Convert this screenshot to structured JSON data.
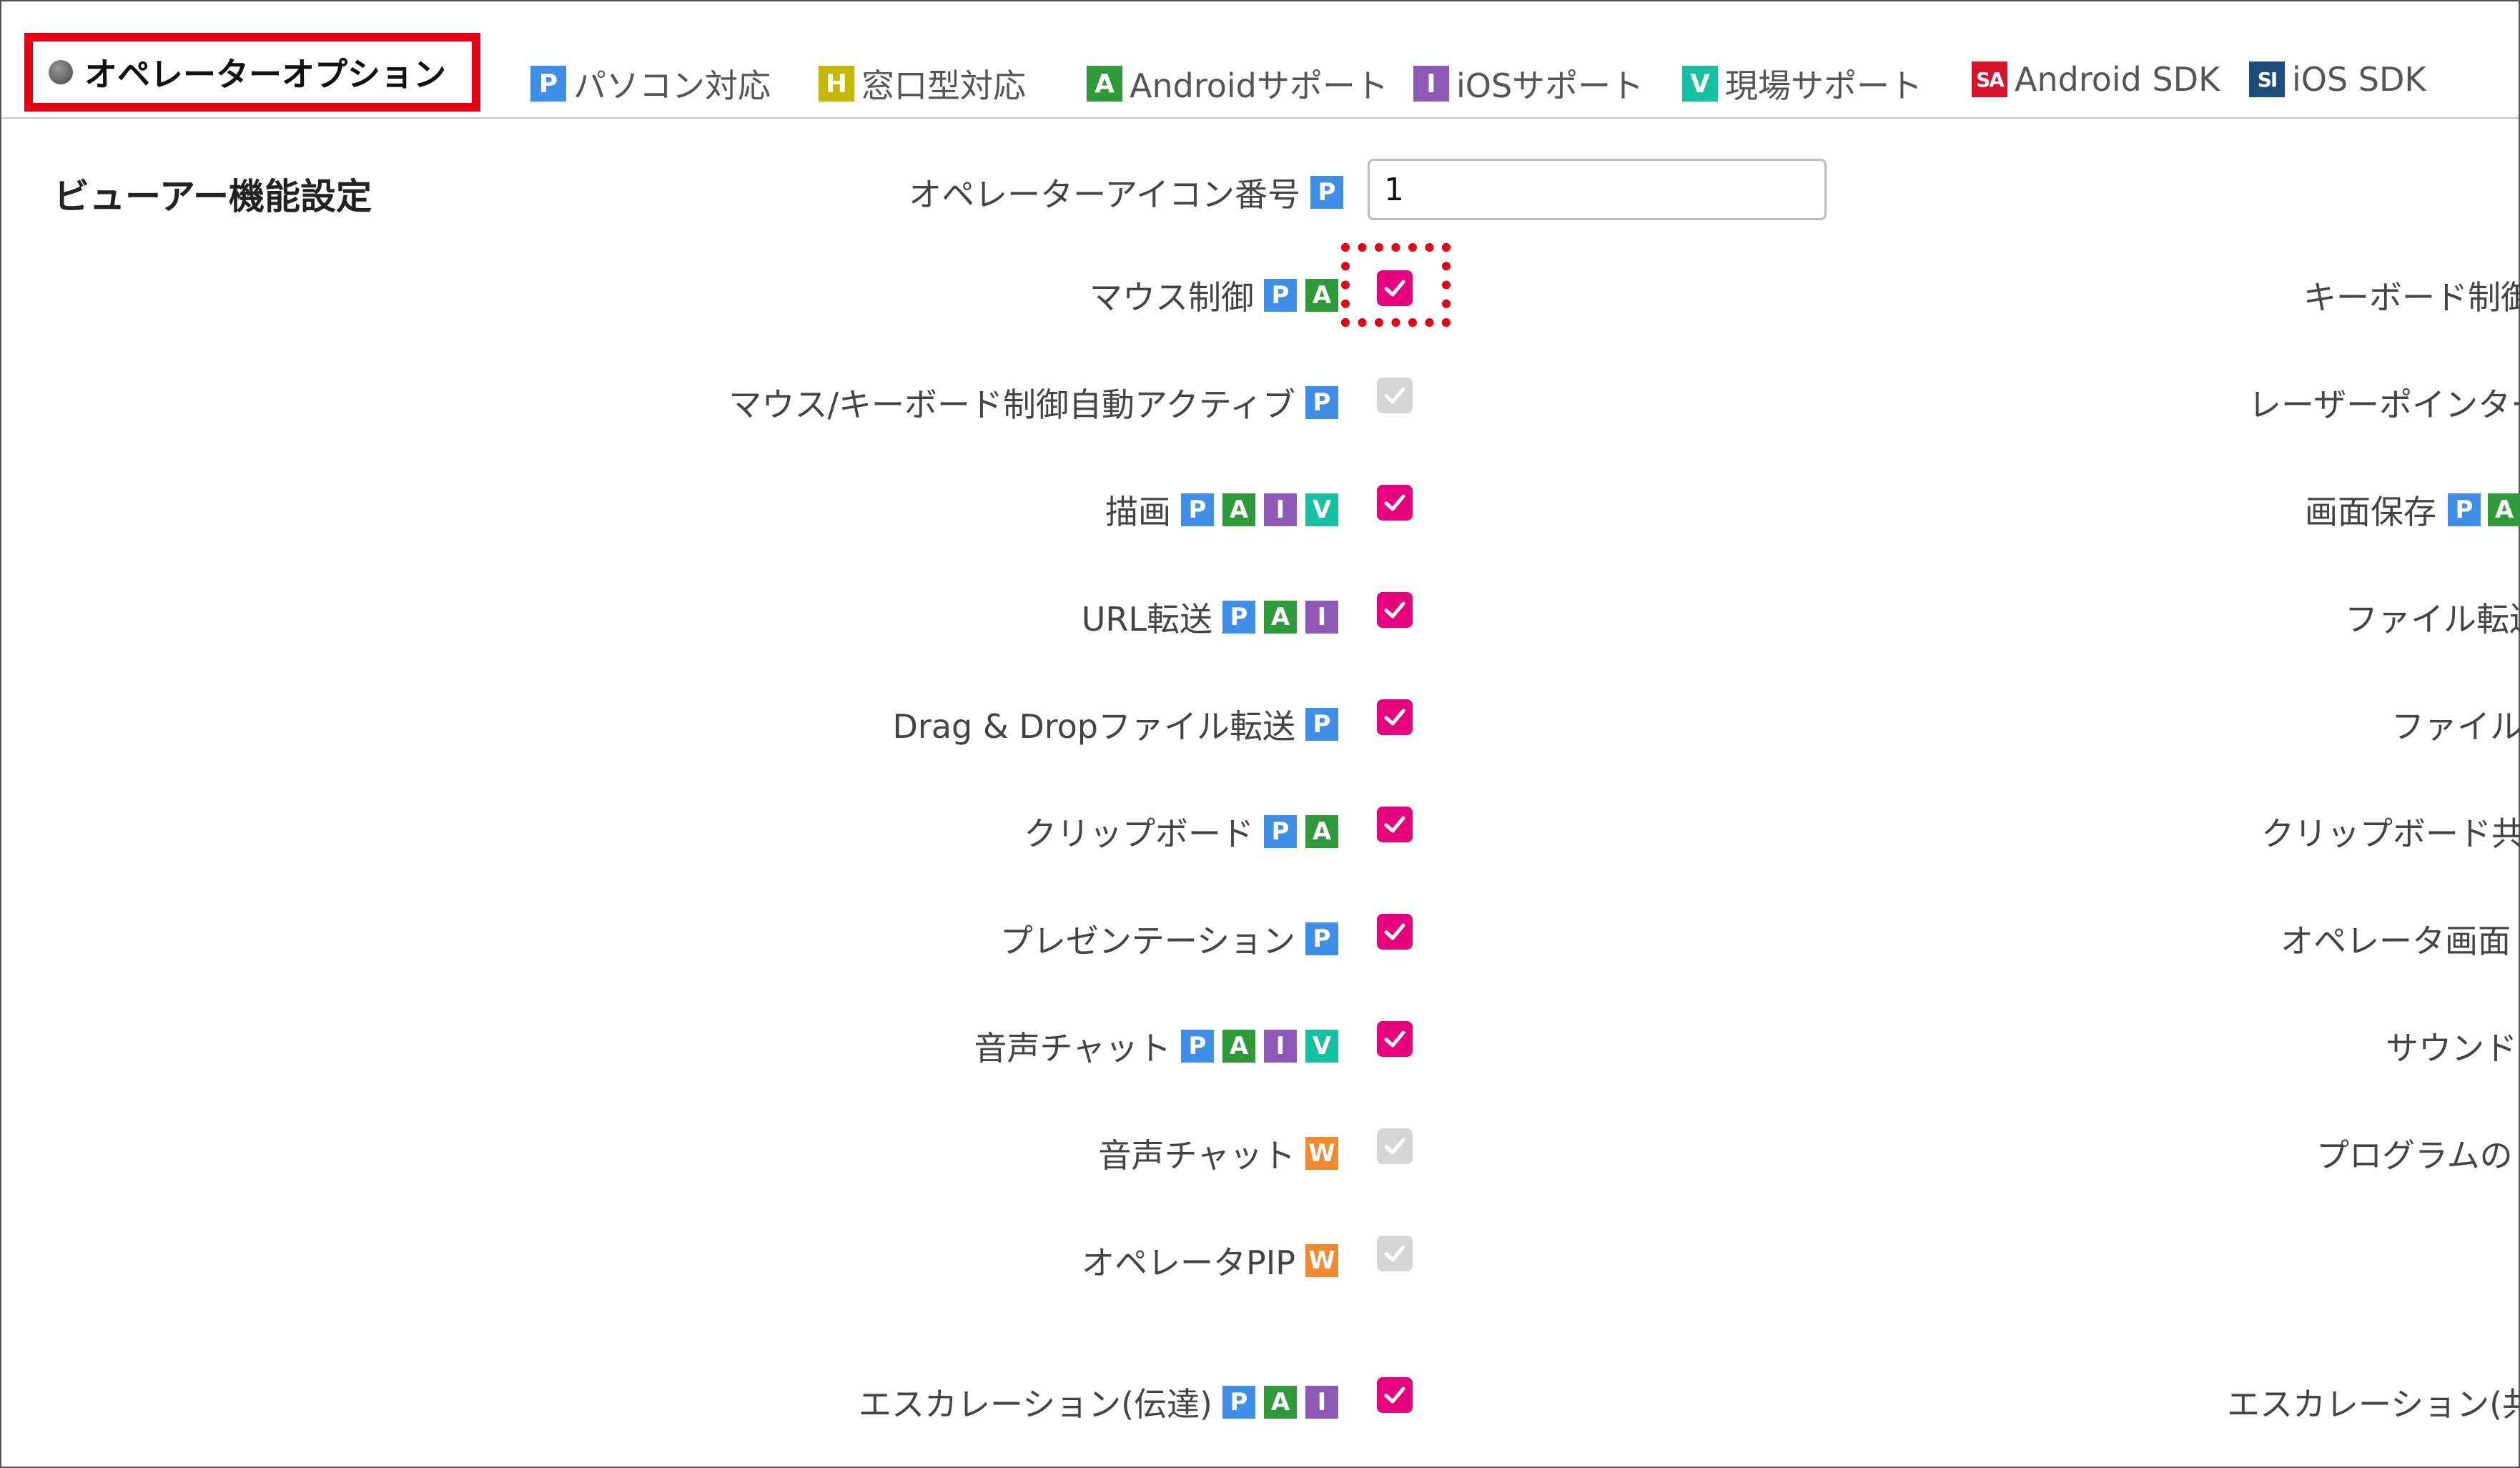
{
  "colors": {
    "accent": "#e6007e",
    "highlight": "#e60012",
    "P": "#3f8ee8",
    "H": "#c5b900",
    "A": "#2e9a3a",
    "I": "#8e58b7",
    "V": "#16c0a3",
    "W": "#f08a2c",
    "SA": "#d7142c",
    "SI": "#1e4d7a"
  },
  "tabs": {
    "active": {
      "label": "オペレーターオプション"
    },
    "legend": [
      {
        "code": "P",
        "text": "パソコン対応"
      },
      {
        "code": "H",
        "text": "窓口型対応"
      },
      {
        "code": "A",
        "text": "Androidサポート"
      },
      {
        "code": "I",
        "text": "iOSサポート"
      },
      {
        "code": "V",
        "text": "現場サポート"
      },
      {
        "code": "SA",
        "text": "Android SDK"
      },
      {
        "code": "SI",
        "text": "iOS SDK"
      }
    ]
  },
  "section": {
    "title": "ビューアー機能設定"
  },
  "icon_number": {
    "label": "オペレーターアイコン番号",
    "badges": [
      "P"
    ],
    "value": "1"
  },
  "settings": [
    {
      "label": "マウス制御",
      "badges": [
        "P",
        "A"
      ],
      "checked": true
    },
    {
      "label": "マウス/キーボード制御自動アクティブ",
      "badges": [
        "P"
      ],
      "checked": false
    },
    {
      "label": "描画",
      "badges": [
        "P",
        "A",
        "I",
        "V"
      ],
      "checked": true
    },
    {
      "label": "URL転送",
      "badges": [
        "P",
        "A",
        "I"
      ],
      "checked": true
    },
    {
      "label": "Drag & Dropファイル転送",
      "badges": [
        "P"
      ],
      "checked": true
    },
    {
      "label": "クリップボード",
      "badges": [
        "P",
        "A"
      ],
      "checked": true
    },
    {
      "label": "プレゼンテーション",
      "badges": [
        "P"
      ],
      "checked": true
    },
    {
      "label": "音声チャット",
      "badges": [
        "P",
        "A",
        "I",
        "V"
      ],
      "checked": true
    },
    {
      "label": "音声チャット",
      "badges": [
        "W"
      ],
      "checked": false
    },
    {
      "label": "オペレータPIP",
      "badges": [
        "W"
      ],
      "checked": false
    },
    {
      "label": "エスカレーション(伝達)",
      "badges": [
        "P",
        "A",
        "I"
      ],
      "checked": true
    }
  ],
  "right_column": [
    {
      "label": "キーボード制御",
      "badges": []
    },
    {
      "label": "レーザーポインター",
      "badges": []
    },
    {
      "label": "画面保存",
      "badges": [
        "P",
        "A"
      ]
    },
    {
      "label": "ファイル転送",
      "badges": []
    },
    {
      "label": "ファイル",
      "badges": []
    },
    {
      "label": "クリップボード共有",
      "badges": []
    },
    {
      "label": "オペレータ画面",
      "badges": []
    },
    {
      "label": "サウンド",
      "badges": []
    },
    {
      "label": "プログラムの",
      "badges": []
    },
    {
      "label": "エスカレーション(共",
      "badges": []
    }
  ]
}
